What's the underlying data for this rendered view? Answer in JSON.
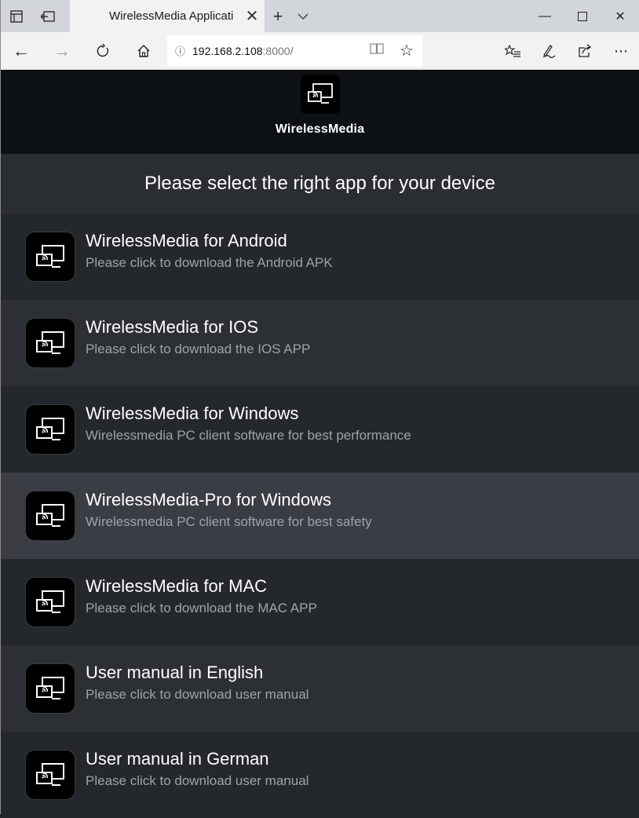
{
  "browser": {
    "tab_title": "WirelessMedia Applicati",
    "url_host": "192.168.2.108",
    "url_port": ":8000/",
    "icons": [
      "tab-preview-icon",
      "set-aside-icon",
      "close-icon",
      "new-tab-icon",
      "chevron-down-icon",
      "minimize-icon",
      "maximize-icon",
      "window-close-icon",
      "back-icon",
      "forward-icon",
      "refresh-icon",
      "home-icon",
      "info-icon",
      "reading-view-icon",
      "favorite-star-icon",
      "favorites-list-icon",
      "pen-icon",
      "share-icon",
      "more-icon"
    ]
  },
  "header": {
    "brand": "WirelessMedia",
    "subtitle": "Please select the right app for your device"
  },
  "items": [
    {
      "title": "WirelessMedia for Android",
      "desc": "Please click to download the Android APK"
    },
    {
      "title": "WirelessMedia for IOS",
      "desc": "Please click to download the IOS APP"
    },
    {
      "title": "WirelessMedia for Windows",
      "desc": "Wirelessmedia PC client software for best performance"
    },
    {
      "title": "WirelessMedia-Pro for Windows",
      "desc": "Wirelessmedia PC client software for best safety"
    },
    {
      "title": "WirelessMedia for MAC",
      "desc": "Please click to download the MAC APP"
    },
    {
      "title": "User manual in English",
      "desc": "Please click to download user manual"
    },
    {
      "title": "User manual in German",
      "desc": "Please click to download user manual"
    }
  ],
  "colors": {
    "header_bg": "#0d1014",
    "subheader_bg": "#2a2e33",
    "row_odd": "#24282d",
    "row_even": "#2c3035",
    "row_hover": "#3a3e44"
  }
}
